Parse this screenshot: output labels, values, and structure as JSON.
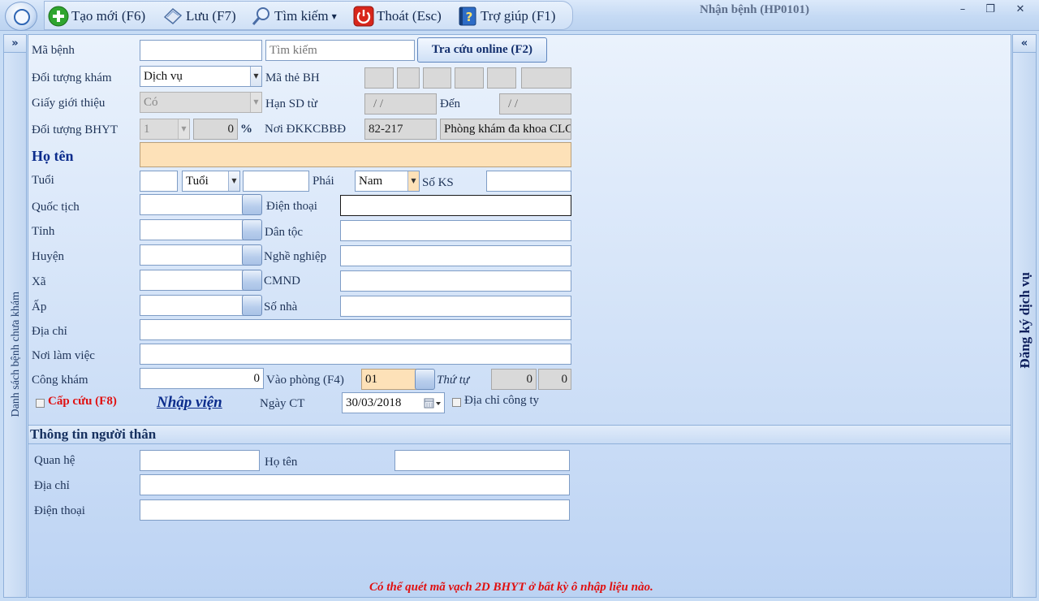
{
  "toolbar": {
    "new_label": "Tạo mới (F6)",
    "save_label": "Lưu (F7)",
    "search_label": "Tìm kiếm",
    "exit_label": "Thoát (Esc)",
    "help_label": "Trợ giúp (F1)"
  },
  "window": {
    "title": "Nhận bệnh (HP0101)",
    "minimize": "–",
    "restore": "❐",
    "close": "✕"
  },
  "side_left": {
    "toggle": "»",
    "label": "Danh sách bệnh chưa khám"
  },
  "side_right": {
    "toggle": "«",
    "label": "Đăng ký dịch vụ"
  },
  "form": {
    "ma_benh_label": "Mã bệnh",
    "ma_benh_value": "",
    "search_placeholder": "Tìm kiếm",
    "tra_cuu_label": "Tra cứu online (F2)",
    "doi_tuong_kham_label": "Đối tượng khám",
    "doi_tuong_kham_value": "Dịch vụ",
    "ma_the_bh_label": "Mã thẻ BH",
    "giay_gioi_thieu_label": "Giấy giới thiệu",
    "giay_gioi_thieu_value": "Có",
    "han_sd_tu_label": "Hạn SD từ",
    "han_sd_tu_value": "/ /",
    "den_label": "Đến",
    "den_value": "/ /",
    "doi_tuong_bhyt_label": "Đối tượng BHYT",
    "doi_tuong_bhyt_value": "1",
    "percent_value": "0",
    "percent_sign": "%",
    "noi_dkkcbbd_label": "Nơi ĐKKCBBĐ",
    "noi_dkkcbbd_code": "82-217",
    "noi_dkkcbbd_name": "Phòng khám đa khoa CLC",
    "ho_ten_label": "Họ tên",
    "tuoi_label": "Tuổi",
    "tuoi_unit": "Tuổi",
    "phai_label": "Phái",
    "phai_value": "Nam",
    "so_ks_label": "Số KS",
    "quoc_tich_label": "Quốc tịch",
    "dien_thoai_label": "Điện thoại",
    "tinh_label": "Tỉnh",
    "dan_toc_label": "Dân tộc",
    "huyen_label": "Huyện",
    "nghe_nghiep_label": "Nghề nghiệp",
    "xa_label": "Xã",
    "cmnd_label": "CMND",
    "ap_label": "Ấp",
    "so_nha_label": "Số nhà",
    "dia_chi_label": "Địa chỉ",
    "noi_lam_viec_label": "Nơi làm việc",
    "cong_kham_label": "Công khám",
    "cong_kham_value": "0",
    "vao_phong_label": "Vào phòng (F4)",
    "vao_phong_value": "01",
    "thu_tu_label": "Thứ tự",
    "thu_tu_value1": "0",
    "thu_tu_value2": "0",
    "cap_cuu_label": "Cấp cứu (F8)",
    "nhap_vien_label": "Nhập viện",
    "ngay_ct_label": "Ngày CT",
    "ngay_ct_value": "30/03/2018",
    "dia_chi_cong_ty_label": "Địa chỉ công ty"
  },
  "relative": {
    "section_title": "Thông tin người thân",
    "quan_he_label": "Quan hệ",
    "ho_ten_label": "Họ tên",
    "dia_chi_label": "Địa chỉ",
    "dien_thoai_label": "Điện thoại"
  },
  "footer_note": "Có thể quét mã vạch 2D BHYT ở bất kỳ ô nhập liệu nào.",
  "colors": {
    "accent_blue": "#0b2c8c",
    "emergency_red": "#e01010",
    "peach_field": "#fde1b8"
  }
}
